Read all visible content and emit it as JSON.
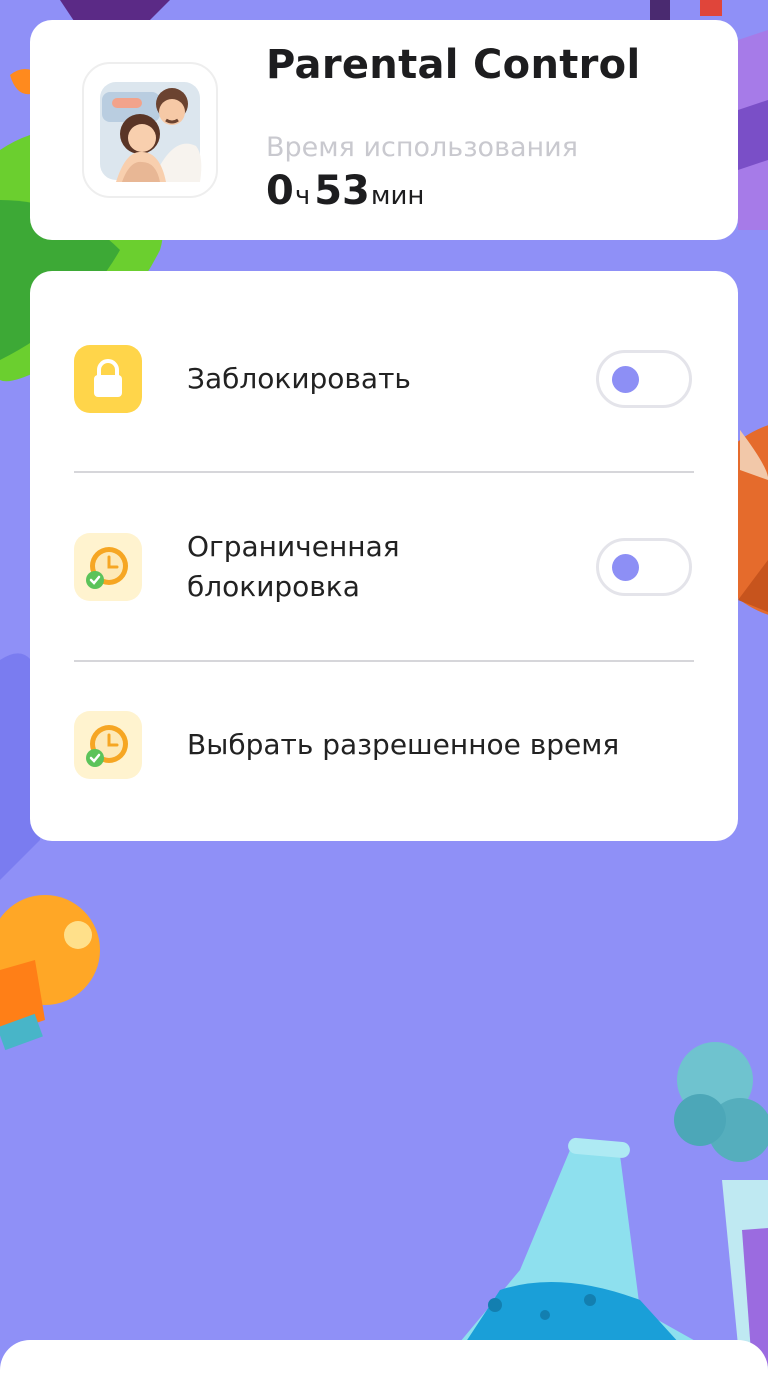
{
  "header": {
    "app_name": "Parental Control",
    "usage_label": "Время использования",
    "usage_hours": "0",
    "hours_unit": "ч",
    "usage_minutes": "53",
    "minutes_unit": "мин"
  },
  "settings": {
    "lock": {
      "label": "Заблокировать",
      "enabled": false,
      "icon": "lock-icon"
    },
    "limited_lock": {
      "label_line1": "Ограниченная",
      "label_line2": "блокировка",
      "enabled": false,
      "icon": "clock-check-icon"
    },
    "allowed_time": {
      "label": "Выбрать разрешенное время",
      "icon": "clock-check-icon"
    }
  },
  "colors": {
    "background": "#8f90f7",
    "accent": "#8d8ff5",
    "lock_icon_bg": "#ffd54a",
    "clock_icon_bg": "#fff3cf",
    "clock_icon": "#f6a623",
    "check_badge": "#5cc35a"
  }
}
